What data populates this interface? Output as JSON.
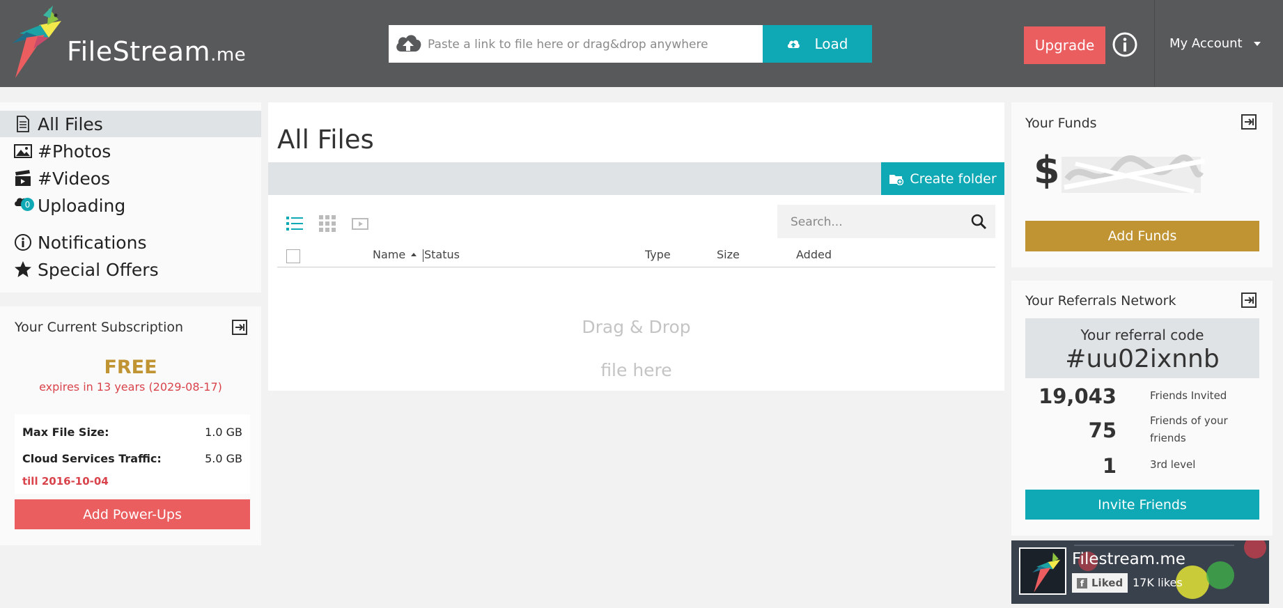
{
  "header": {
    "logo_main": "FileStream",
    "logo_tld": ".me",
    "link_placeholder": "Paste a link to file here or drag&drop anywhere",
    "load_label": "Load",
    "upgrade_label": "Upgrade",
    "account_label": "My Account"
  },
  "sidebar": {
    "items": [
      {
        "label": "All Files",
        "icon": "document-icon",
        "active": true
      },
      {
        "label": "#Photos",
        "icon": "image-icon"
      },
      {
        "label": "#Videos",
        "icon": "clapper-icon"
      },
      {
        "label": "Uploading",
        "icon": "cloud-icon",
        "badge": "0"
      },
      {
        "label": "Notifications",
        "icon": "info-icon"
      },
      {
        "label": "Special Offers",
        "icon": "star-icon"
      }
    ]
  },
  "subscription": {
    "title": "Your Current Subscription",
    "plan": "FREE",
    "expires": "expires in 13 years (2029-08-17)",
    "max_file_size_label": "Max File Size:",
    "max_file_size": "1.0 GB",
    "traffic_label": "Cloud Services Traffic:",
    "traffic": "5.0 GB",
    "traffic_till": "till 2016-10-04",
    "powerups_label": "Add Power-Ups"
  },
  "main": {
    "title": "All Files",
    "create_folder_label": "Create folder",
    "search_placeholder": "Search...",
    "columns": [
      "Name",
      "Status",
      "Type",
      "Size",
      "Added"
    ],
    "drop_line1": "Drag & Drop",
    "drop_line2": "file here"
  },
  "funds": {
    "title": "Your Funds",
    "currency": "$",
    "add_funds_label": "Add Funds"
  },
  "referrals": {
    "title": "Your Referrals Network",
    "code_label": "Your referral code",
    "code": "#uu02ixnnb",
    "stats": [
      {
        "value": "19,043",
        "label": "Friends Invited"
      },
      {
        "value": "75",
        "label": "Friends of your friends"
      },
      {
        "value": "1",
        "label": "3rd level"
      }
    ],
    "invite_label": "Invite Friends"
  },
  "facebook": {
    "page_name": "Filestream.me",
    "liked_label": "Liked",
    "likes": "17K likes"
  },
  "colors": {
    "header_bg": "#58595b",
    "teal": "#0fa8b5",
    "coral": "#eb5e60",
    "gold": "#c09432",
    "panel_gray": "#dfe3e5"
  }
}
